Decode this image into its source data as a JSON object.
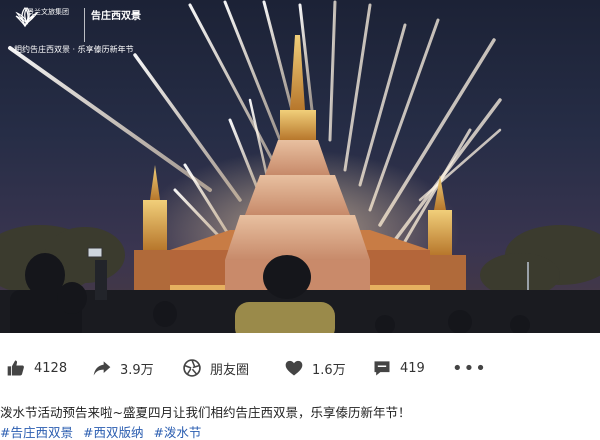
{
  "brand": {
    "group_name": "景兰文旅集团",
    "scenic_name": "告庄西双景",
    "slogan": "相约告庄西双景 · 乐享傣历新年节"
  },
  "actions": {
    "like_count": "4128",
    "share_count": "3.9万",
    "moments_label": "朋友圈",
    "favorite_count": "1.6万",
    "comment_count": "419",
    "more_label": "•••"
  },
  "post": {
    "caption": "泼水节活动预告来啦~盛夏四月让我们相约告庄西双景，乐享傣历新年节！",
    "tags": [
      "#告庄西双景",
      "#西双版纳",
      "#泼水节"
    ]
  },
  "colors": {
    "tag": "#2a5db0",
    "text": "#222222",
    "sky": "#262d46",
    "temple_gold": "#d9a54a"
  }
}
